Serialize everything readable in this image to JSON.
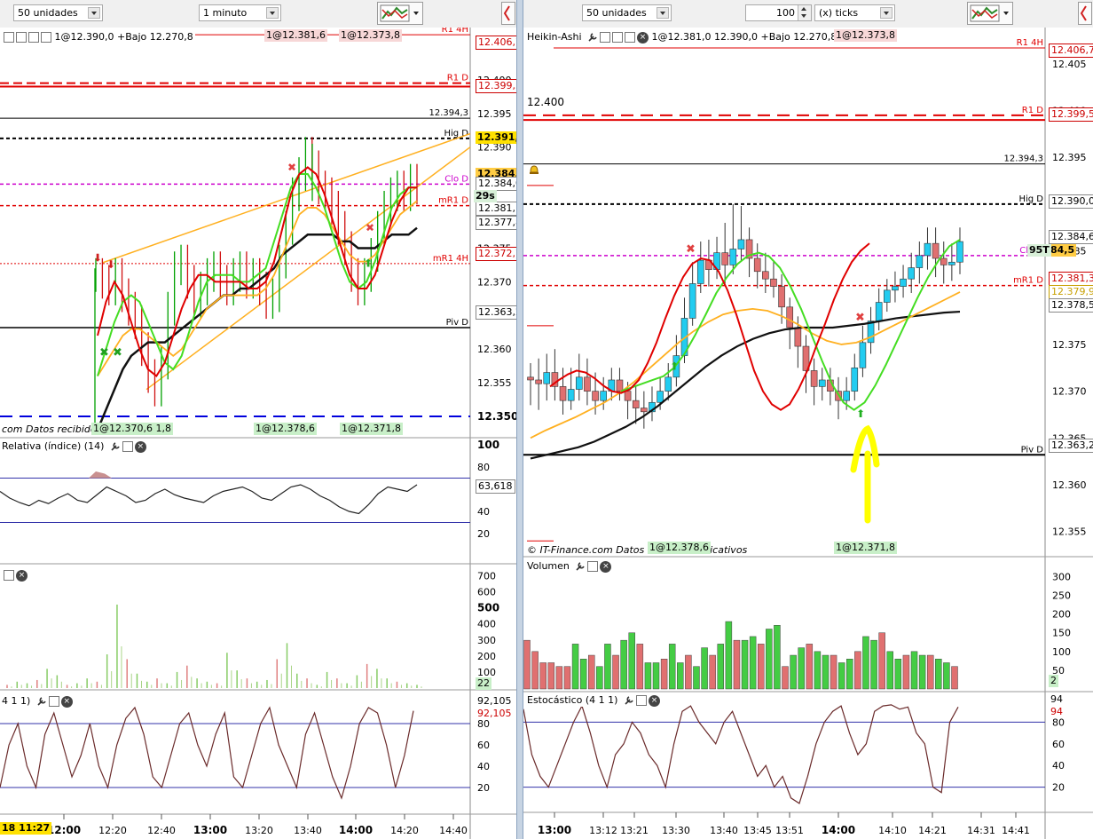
{
  "toolbar": {
    "left_units": "50 unidades",
    "left_interval": "1 minuto",
    "right_units": "50 unidades",
    "right_ticks_value": "100",
    "right_ticks_unit": "(x) ticks"
  },
  "left_chart": {
    "header_info": "1@12.390,0 +Bajo 12.270,8",
    "header_quote_1": "1@12.381,6",
    "header_quote_2": "1@12.373,8",
    "credit": "com  Datos recibidos indicativos",
    "footer_quote_0": "1@12.370,6 1,8",
    "footer_quote_1": "1@12.378,6",
    "footer_quote_2": "1@12.371,8",
    "countdown": "29s",
    "axis_ticks": [
      "12.405",
      "12.400",
      "12.395",
      "12.390",
      "12.385",
      "12.380",
      "12.375",
      "12.370",
      "12.365",
      "12.360",
      "12.355",
      "12.350"
    ],
    "levels": [
      {
        "label": "R1 4H",
        "value": "12.406,7"
      },
      {
        "label": "R1 D",
        "value": "12.399,5"
      },
      {
        "label": "12.394,3",
        "value": ""
      },
      {
        "label": "Hig D",
        "value": "12.391,3"
      },
      {
        "label": "Clo D",
        "value": "12.384,5"
      },
      {
        "label": "mR1 D",
        "value": "12.381,3"
      },
      {
        "label": "mR1 4H",
        "value": "12.372,7"
      },
      {
        "label": "Piv D",
        "value": "12.363,2"
      }
    ],
    "price_box_high": "12.390,0",
    "price_box_last": "12.384,0",
    "price_box_2": "12.377,8",
    "price_box_3": "12.381,1",
    "colors": {
      "up": "#00a000",
      "down": "#d01010",
      "red_line": "#e00000",
      "magenta": "#cc00cc",
      "orange": "#ffb020",
      "green_ma": "#44dd22",
      "black_ma": "#111111",
      "blue_dash": "#0000dd"
    }
  },
  "left_rsi": {
    "title": "Relativa (índice) (14)",
    "value": "63,618",
    "ticks": [
      "100",
      "80",
      "60",
      "40",
      "20"
    ]
  },
  "left_volume": {
    "ticks": [
      "700",
      "600",
      "500",
      "400",
      "300",
      "200",
      "100"
    ],
    "value": "22"
  },
  "left_stoch": {
    "title": "4 1 1)",
    "value_1": "92,105",
    "value_2": "92,105",
    "ticks": [
      "80",
      "60",
      "40",
      "20"
    ]
  },
  "left_time_axis": {
    "start_label": "18 11:27",
    "labels": [
      "12:00",
      "12:20",
      "12:40",
      "13:00",
      "13:20",
      "13:40",
      "14:00",
      "14:20",
      "14:40"
    ]
  },
  "right_chart": {
    "header_title": "Heikin-Ashi",
    "header_info": "1@12.381,0 12.390,0 +Bajo 12.270,8",
    "header_quote": "1@12.373,8",
    "big_label": "12.400",
    "credit": "© IT-Finance.com  Datos recibidos indicativos",
    "footer_quote_1": "1@12.378,6",
    "footer_quote_2": "1@12.371,8",
    "countdown": "95T",
    "axis_ticks": [
      "12.405",
      "12.400",
      "12.395",
      "12.390",
      "12.385",
      "12.380",
      "12.375",
      "12.370",
      "12.365",
      "12.360",
      "12.355"
    ],
    "levels": [
      {
        "label": "R1 4H",
        "value": "12.406,7"
      },
      {
        "label": "R1 D",
        "value": "12.399,5"
      },
      {
        "label": "12.394,3",
        "value": ""
      },
      {
        "label": "Hig D",
        "value": "12.390,0"
      },
      {
        "label": "Clo D",
        "value": "12.384,5"
      },
      {
        "label": "mR1 D",
        "value": "12.381,3"
      },
      {
        "label": "Piv D",
        "value": "12.363,2"
      }
    ],
    "price_box_1": "12.384,6",
    "price_box_2": "12.379,9",
    "price_box_3": "12.378,5",
    "price_box_clo": "84,5"
  },
  "right_volume": {
    "title": "Volumen",
    "ticks": [
      "300",
      "250",
      "200",
      "150",
      "100",
      "50"
    ],
    "value": "2"
  },
  "right_stoch": {
    "title": "Estocástico (4 1 1)",
    "value_1": "94",
    "value_2": "94",
    "ticks": [
      "80",
      "60",
      "40",
      "20"
    ]
  },
  "right_time_axis": {
    "labels": [
      "13:00",
      "13:12",
      "13:21",
      "13:30",
      "13:40",
      "13:45",
      "13:51",
      "14:00",
      "14:10",
      "14:21",
      "14:31",
      "14:41"
    ]
  },
  "ha_candles": [
    {
      "o": 12.3715,
      "c": 12.3712,
      "h": 12.373,
      "l": 12.3685
    },
    {
      "o": 12.3712,
      "c": 12.3708,
      "h": 12.3735,
      "l": 12.368
    },
    {
      "o": 12.3708,
      "c": 12.372,
      "h": 12.374,
      "l": 12.369
    },
    {
      "o": 12.372,
      "c": 12.3705,
      "h": 12.3745,
      "l": 12.369
    },
    {
      "o": 12.3705,
      "c": 12.369,
      "h": 12.3725,
      "l": 12.3675
    },
    {
      "o": 12.369,
      "c": 12.3702,
      "h": 12.3725,
      "l": 12.368
    },
    {
      "o": 12.3702,
      "c": 12.3715,
      "h": 12.374,
      "l": 12.369
    },
    {
      "o": 12.3715,
      "c": 12.37,
      "h": 12.3735,
      "l": 12.3685
    },
    {
      "o": 12.37,
      "c": 12.369,
      "h": 12.372,
      "l": 12.3675
    },
    {
      "o": 12.369,
      "c": 12.37,
      "h": 12.3715,
      "l": 12.368
    },
    {
      "o": 12.37,
      "c": 12.3712,
      "h": 12.3725,
      "l": 12.369
    },
    {
      "o": 12.3712,
      "c": 12.37,
      "h": 12.3725,
      "l": 12.369
    },
    {
      "o": 12.37,
      "c": 12.369,
      "h": 12.371,
      "l": 12.367
    },
    {
      "o": 12.369,
      "c": 12.3682,
      "h": 12.3705,
      "l": 12.3665
    },
    {
      "o": 12.3682,
      "c": 12.3678,
      "h": 12.37,
      "l": 12.366
    },
    {
      "o": 12.3678,
      "c": 12.3688,
      "h": 12.3705,
      "l": 12.3668
    },
    {
      "o": 12.3688,
      "c": 12.37,
      "h": 12.3715,
      "l": 12.368
    },
    {
      "o": 12.37,
      "c": 12.3715,
      "h": 12.373,
      "l": 12.369
    },
    {
      "o": 12.3715,
      "c": 12.3738,
      "h": 12.376,
      "l": 12.3705
    },
    {
      "o": 12.3738,
      "c": 12.3778,
      "h": 12.38,
      "l": 12.373
    },
    {
      "o": 12.3778,
      "c": 12.3815,
      "h": 12.3838,
      "l": 12.377
    },
    {
      "o": 12.3815,
      "c": 12.384,
      "h": 12.386,
      "l": 12.3805
    },
    {
      "o": 12.384,
      "c": 12.383,
      "h": 12.3862,
      "l": 12.3812
    },
    {
      "o": 12.383,
      "c": 12.3848,
      "h": 12.3865,
      "l": 12.382
    },
    {
      "o": 12.3848,
      "c": 12.3835,
      "h": 12.388,
      "l": 12.3815
    },
    {
      "o": 12.3835,
      "c": 12.3852,
      "h": 12.39,
      "l": 12.3825
    },
    {
      "o": 12.3852,
      "c": 12.3862,
      "h": 12.3898,
      "l": 12.384
    },
    {
      "o": 12.3862,
      "c": 12.3842,
      "h": 12.3875,
      "l": 12.3822
    },
    {
      "o": 12.3842,
      "c": 12.3828,
      "h": 12.3858,
      "l": 12.381
    },
    {
      "o": 12.3828,
      "c": 12.382,
      "h": 12.3848,
      "l": 12.3805
    },
    {
      "o": 12.382,
      "c": 12.3812,
      "h": 12.384,
      "l": 12.38
    },
    {
      "o": 12.3812,
      "c": 12.379,
      "h": 12.3825,
      "l": 12.3772
    },
    {
      "o": 12.379,
      "c": 12.3768,
      "h": 12.38,
      "l": 12.3745
    },
    {
      "o": 12.3768,
      "c": 12.3748,
      "h": 12.378,
      "l": 12.3725
    },
    {
      "o": 12.3748,
      "c": 12.3722,
      "h": 12.376,
      "l": 12.3698
    },
    {
      "o": 12.3722,
      "c": 12.3705,
      "h": 12.3735,
      "l": 12.3685
    },
    {
      "o": 12.3705,
      "c": 12.3712,
      "h": 12.3725,
      "l": 12.369
    },
    {
      "o": 12.3712,
      "c": 12.37,
      "h": 12.3725,
      "l": 12.3685
    },
    {
      "o": 12.37,
      "c": 12.369,
      "h": 12.3715,
      "l": 12.367
    },
    {
      "o": 12.369,
      "c": 12.37,
      "h": 12.3715,
      "l": 12.368
    },
    {
      "o": 12.37,
      "c": 12.3725,
      "h": 12.374,
      "l": 12.369
    },
    {
      "o": 12.3725,
      "c": 12.3752,
      "h": 12.377,
      "l": 12.3715
    },
    {
      "o": 12.3752,
      "c": 12.3775,
      "h": 12.379,
      "l": 12.374
    },
    {
      "o": 12.3775,
      "c": 12.3795,
      "h": 12.381,
      "l": 12.3765
    },
    {
      "o": 12.3795,
      "c": 12.3808,
      "h": 12.382,
      "l": 12.3785
    },
    {
      "o": 12.3808,
      "c": 12.3812,
      "h": 12.3828,
      "l": 12.3795
    },
    {
      "o": 12.3812,
      "c": 12.382,
      "h": 12.3835,
      "l": 12.38
    },
    {
      "o": 12.382,
      "c": 12.3832,
      "h": 12.3848,
      "l": 12.3805
    },
    {
      "o": 12.3832,
      "c": 12.3845,
      "h": 12.386,
      "l": 12.3815
    },
    {
      "o": 12.3845,
      "c": 12.3858,
      "h": 12.3875,
      "l": 12.383
    },
    {
      "o": 12.3858,
      "c": 12.3842,
      "h": 12.3875,
      "l": 12.3822
    },
    {
      "o": 12.3842,
      "c": 12.3835,
      "h": 12.386,
      "l": 12.3815
    },
    {
      "o": 12.3835,
      "c": 12.3838,
      "h": 12.3858,
      "l": 12.3818
    },
    {
      "o": 12.3838,
      "c": 12.386,
      "h": 12.3875,
      "l": 12.3825
    }
  ],
  "left_price_series": [
    12.371,
    12.37,
    12.369,
    12.371,
    12.368,
    12.366,
    12.364,
    12.36,
    12.356,
    12.354,
    12.358,
    12.366,
    12.372,
    12.373,
    12.37,
    12.367,
    12.369,
    12.371,
    12.372,
    12.37,
    12.369,
    12.371,
    12.372,
    12.37,
    12.371,
    12.369,
    12.367,
    12.368,
    12.373,
    12.378,
    12.383,
    12.386,
    12.389,
    12.387,
    12.384,
    12.383,
    12.381,
    12.378,
    12.375,
    12.371,
    12.369,
    12.371,
    12.374,
    12.378,
    12.381,
    12.383,
    12.384,
    12.383,
    12.385,
    12.384
  ],
  "left_red_ma": [
    12.362,
    12.367,
    12.37,
    12.368,
    12.364,
    12.36,
    12.357,
    12.356,
    12.358,
    12.362,
    12.366,
    12.369,
    12.371,
    12.371,
    12.37,
    12.37,
    12.37,
    12.37,
    12.369,
    12.369,
    12.37,
    12.373,
    12.378,
    12.383,
    12.386,
    12.387,
    12.386,
    12.383,
    12.379,
    12.375,
    12.371,
    12.369,
    12.369,
    12.371,
    12.375,
    12.379,
    12.382,
    12.384,
    12.384
  ],
  "left_green_ma": [
    12.356,
    12.36,
    12.364,
    12.367,
    12.368,
    12.367,
    12.364,
    12.361,
    12.358,
    12.357,
    12.359,
    12.363,
    12.367,
    12.37,
    12.371,
    12.371,
    12.371,
    12.37,
    12.37,
    12.371,
    12.372,
    12.376,
    12.38,
    12.384,
    12.386,
    12.386,
    12.384,
    12.381,
    12.377,
    12.373,
    12.37,
    12.369,
    12.37,
    12.373,
    12.377,
    12.381,
    12.383,
    12.384,
    12.384
  ],
  "left_orange_ma": [
    12.356,
    12.358,
    12.36,
    12.362,
    12.363,
    12.363,
    12.362,
    12.361,
    12.36,
    12.359,
    12.36,
    12.362,
    12.364,
    12.366,
    12.367,
    12.368,
    12.368,
    12.368,
    12.368,
    12.368,
    12.369,
    12.371,
    12.374,
    12.377,
    12.38,
    12.381,
    12.381,
    12.38,
    12.378,
    12.376,
    12.374,
    12.373,
    12.373,
    12.374,
    12.376,
    12.378,
    12.38,
    12.381,
    12.382
  ],
  "left_black_ma": [
    12.348,
    12.351,
    12.354,
    12.357,
    12.359,
    12.36,
    12.361,
    12.361,
    12.361,
    12.362,
    12.363,
    12.364,
    12.365,
    12.366,
    12.367,
    12.368,
    12.368,
    12.369,
    12.369,
    12.37,
    12.371,
    12.372,
    12.374,
    12.375,
    12.376,
    12.377,
    12.377,
    12.377,
    12.377,
    12.376,
    12.376,
    12.375,
    12.375,
    12.375,
    12.376,
    12.377,
    12.377,
    12.377,
    12.378
  ],
  "right_red_ma": [
    12.3705,
    12.3712,
    12.3718,
    12.3722,
    12.372,
    12.3714,
    12.3706,
    12.37,
    12.3698,
    12.3702,
    12.3712,
    12.373,
    12.3752,
    12.3778,
    12.3802,
    12.3822,
    12.3836,
    12.3842,
    12.384,
    12.3828,
    12.3808,
    12.3782,
    12.3752,
    12.3722,
    12.37,
    12.3686,
    12.368,
    12.3686,
    12.3702,
    12.3722,
    12.3748,
    12.3772,
    12.3798,
    12.382,
    12.3838,
    12.385,
    12.3858
  ],
  "right_green_ma": [
    12.37,
    12.3704,
    12.3708,
    12.3712,
    12.3716,
    12.3725,
    12.374,
    12.376,
    12.3782,
    12.3805,
    12.3822,
    12.3836,
    12.3845,
    12.3848,
    12.3844,
    12.3832,
    12.3812,
    12.3788,
    12.376,
    12.3732,
    12.3706,
    12.3688,
    12.368,
    12.3688,
    12.3706,
    12.3728,
    12.3752,
    12.3776,
    12.38,
    12.3822,
    12.384,
    12.3855,
    12.3862
  ],
  "right_orange_ma": [
    12.365,
    12.3658,
    12.3665,
    12.3672,
    12.368,
    12.3688,
    12.3698,
    12.371,
    12.3724,
    12.3738,
    12.3752,
    12.3764,
    12.3774,
    12.3782,
    12.3786,
    12.3788,
    12.3786,
    12.378,
    12.3772,
    12.3762,
    12.3754,
    12.375,
    12.3752,
    12.3758,
    12.3766,
    12.3774,
    12.3782,
    12.379,
    12.3798,
    12.3806
  ],
  "right_black_ma": [
    12.3628,
    12.3632,
    12.3636,
    12.364,
    12.3646,
    12.3654,
    12.3662,
    12.3672,
    12.3684,
    12.3698,
    12.3712,
    12.3726,
    12.3738,
    12.3748,
    12.3756,
    12.3762,
    12.3766,
    12.3768,
    12.3768,
    12.3768,
    12.377,
    12.3772,
    12.3775,
    12.3778,
    12.378,
    12.3782,
    12.3784,
    12.3785
  ],
  "right_volume_values": [
    130,
    100,
    70,
    70,
    60,
    60,
    120,
    80,
    90,
    60,
    120,
    90,
    130,
    150,
    120,
    70,
    70,
    80,
    120,
    70,
    90,
    60,
    110,
    90,
    120,
    180,
    130,
    130,
    140,
    120,
    160,
    170,
    60,
    90,
    110,
    120,
    100,
    90,
    90,
    70,
    80,
    100,
    140,
    130,
    150,
    100,
    80,
    90,
    100,
    90,
    90,
    80,
    70,
    60
  ],
  "right_stoch_values": [
    92,
    50,
    30,
    20,
    40,
    60,
    80,
    95,
    70,
    40,
    20,
    50,
    60,
    80,
    70,
    50,
    40,
    20,
    60,
    90,
    95,
    80,
    70,
    60,
    80,
    90,
    70,
    50,
    30,
    40,
    20,
    30,
    10,
    5,
    30,
    60,
    80,
    90,
    95,
    70,
    50,
    60,
    90,
    95,
    96,
    92,
    94,
    70,
    60,
    20,
    15,
    80,
    94
  ],
  "left_volume_values": [
    20,
    40,
    30,
    50,
    120,
    80,
    20,
    30,
    60,
    40,
    210,
    520,
    180,
    90,
    40,
    60,
    30,
    100,
    140,
    60,
    40,
    30,
    220,
    110,
    60,
    40,
    50,
    180,
    280,
    90,
    60,
    20,
    100,
    60,
    30,
    80,
    150,
    120,
    60,
    40,
    30,
    20
  ],
  "left_rsi_values": [
    58,
    52,
    48,
    45,
    50,
    47,
    52,
    56,
    50,
    48,
    55,
    62,
    58,
    54,
    48,
    50,
    56,
    60,
    55,
    52,
    50,
    48,
    54,
    58,
    60,
    62,
    58,
    52,
    50,
    56,
    62,
    64,
    60,
    54,
    50,
    44,
    40,
    38,
    46,
    56,
    62,
    60,
    58,
    64
  ],
  "left_stoch_values": [
    20,
    60,
    80,
    40,
    20,
    70,
    90,
    60,
    30,
    50,
    80,
    40,
    20,
    60,
    85,
    95,
    70,
    30,
    20,
    50,
    80,
    90,
    60,
    40,
    70,
    90,
    30,
    20,
    50,
    80,
    95,
    60,
    40,
    20,
    70,
    90,
    60,
    30,
    10,
    40,
    80,
    95,
    90,
    60,
    20,
    50,
    92
  ]
}
